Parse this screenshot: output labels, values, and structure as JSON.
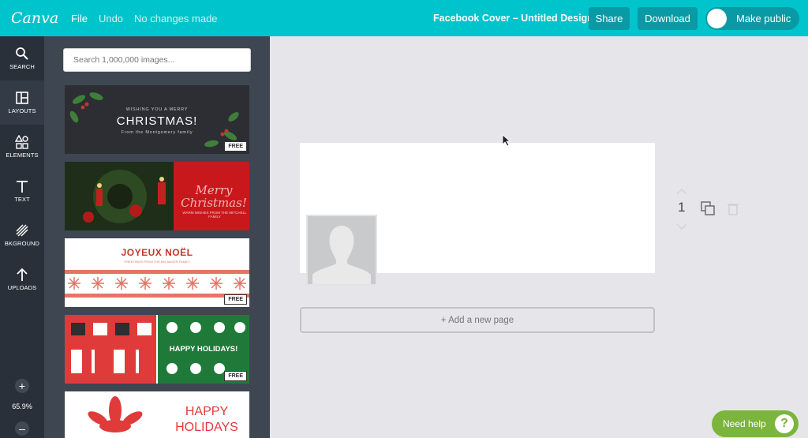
{
  "topbar": {
    "logo": "Canva",
    "menu_file": "File",
    "menu_undo": "Undo",
    "save_status": "No changes made",
    "doc_title": "Facebook Cover – Untitled Design",
    "share_label": "Share",
    "download_label": "Download",
    "make_public_label": "Make public",
    "make_public_on": false
  },
  "rail": {
    "items": [
      {
        "label": "SEARCH",
        "icon": "search-icon"
      },
      {
        "label": "LAYOUTS",
        "icon": "layouts-icon"
      },
      {
        "label": "ELEMENTS",
        "icon": "elements-icon"
      },
      {
        "label": "TEXT",
        "icon": "text-icon"
      },
      {
        "label": "BKGROUND",
        "icon": "background-icon"
      },
      {
        "label": "UPLOADS",
        "icon": "upload-icon"
      }
    ],
    "active": "LAYOUTS",
    "zoom_in": "+",
    "zoom_out": "–",
    "zoom_level": "65.9%"
  },
  "panel": {
    "search_placeholder": "Search 1,000,000 images...",
    "layouts": [
      {
        "title": "CHRISTMAS!",
        "small_top": "WISHING YOU A MERRY",
        "small_bottom": "From the Montgomery family",
        "badge": "FREE"
      },
      {
        "title": "Merry Christmas!",
        "sub": "WARM WISHES FROM THE MITCHELL FAMILY",
        "badge": ""
      },
      {
        "title": "JOYEUX NOËL",
        "sub": "GREETINGS FROM THE BELANGER FAMILY",
        "badge": "FREE"
      },
      {
        "title": "HAPPY HOLIDAYS!",
        "badge": "FREE"
      },
      {
        "title": "HAPPY HOLIDAYS",
        "badge": ""
      }
    ]
  },
  "canvas": {
    "page_number": "1",
    "add_page_label": "+ Add a new page"
  },
  "help": {
    "label": "Need help",
    "icon_text": "?"
  },
  "colors": {
    "topbar": "#00c4cc",
    "rail": "#293039",
    "panel": "#3e4651",
    "canvas_bg": "#e6e5e9",
    "help": "#7cb53c"
  }
}
